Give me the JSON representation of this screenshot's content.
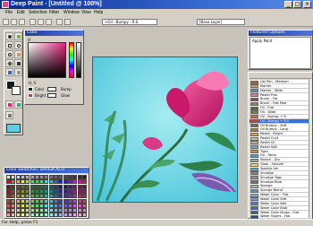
{
  "window": {
    "title": "Deep Paint - [Untitled @ 100%]"
  },
  "menu": [
    "File",
    "Edit",
    "Selection",
    "Filter",
    "Window",
    "View",
    "Help"
  ],
  "toolbar": {
    "brush_field": "<Oil - Bumpy - R.S",
    "layer_field": "[Base Layer]"
  },
  "color_panel": {
    "title": "Color",
    "mode_label": "H",
    "value_label": "H, S",
    "color_label": "Color",
    "bright_label": "Bright",
    "bump_label": "Bump",
    "glow_label": "Glow"
  },
  "swatches_panel": {
    "title": "Color Swatches: Default.ACO"
  },
  "featured": {
    "title": "Featured Options",
    "apply_label": "Apply Paint"
  },
  "presets": [
    "Gel Pen - Medium",
    "Marker",
    "Marker - Wide",
    "Pastel Fine",
    "Brush - Fat",
    "Brush - Flat Mod",
    "Oil - Flat",
    "Oil - Wide",
    "Oil - Bumpy + R",
    "Oil - Bumpy + R.S",
    "Oil Bumpy - Soft",
    "Oil Bumpy - Long",
    "Pastel - Bright",
    "Pastel Cnvt",
    "Pastel Clr",
    "Pastel Soft",
    "Tiger",
    "Fill - Tame",
    "Sketch - Dry",
    "Glow - Smooth",
    "Sparkle Ink",
    "Smudge",
    "Smudge Tags",
    "Smudge Blob",
    "Sponge",
    "Sponge Blend",
    "Water Color - Flat",
    "Water Color Soft",
    "Water Color Wet",
    "Water Color Blob",
    "Water Color Drops - Flat",
    "Water Tapers - Flat"
  ],
  "selected_preset_index": 9,
  "status": "For Help, press F1",
  "colors": {
    "accent": "#3a6fd8",
    "canvas_bg": "#7ad9e6",
    "flower": "#e0247a"
  }
}
